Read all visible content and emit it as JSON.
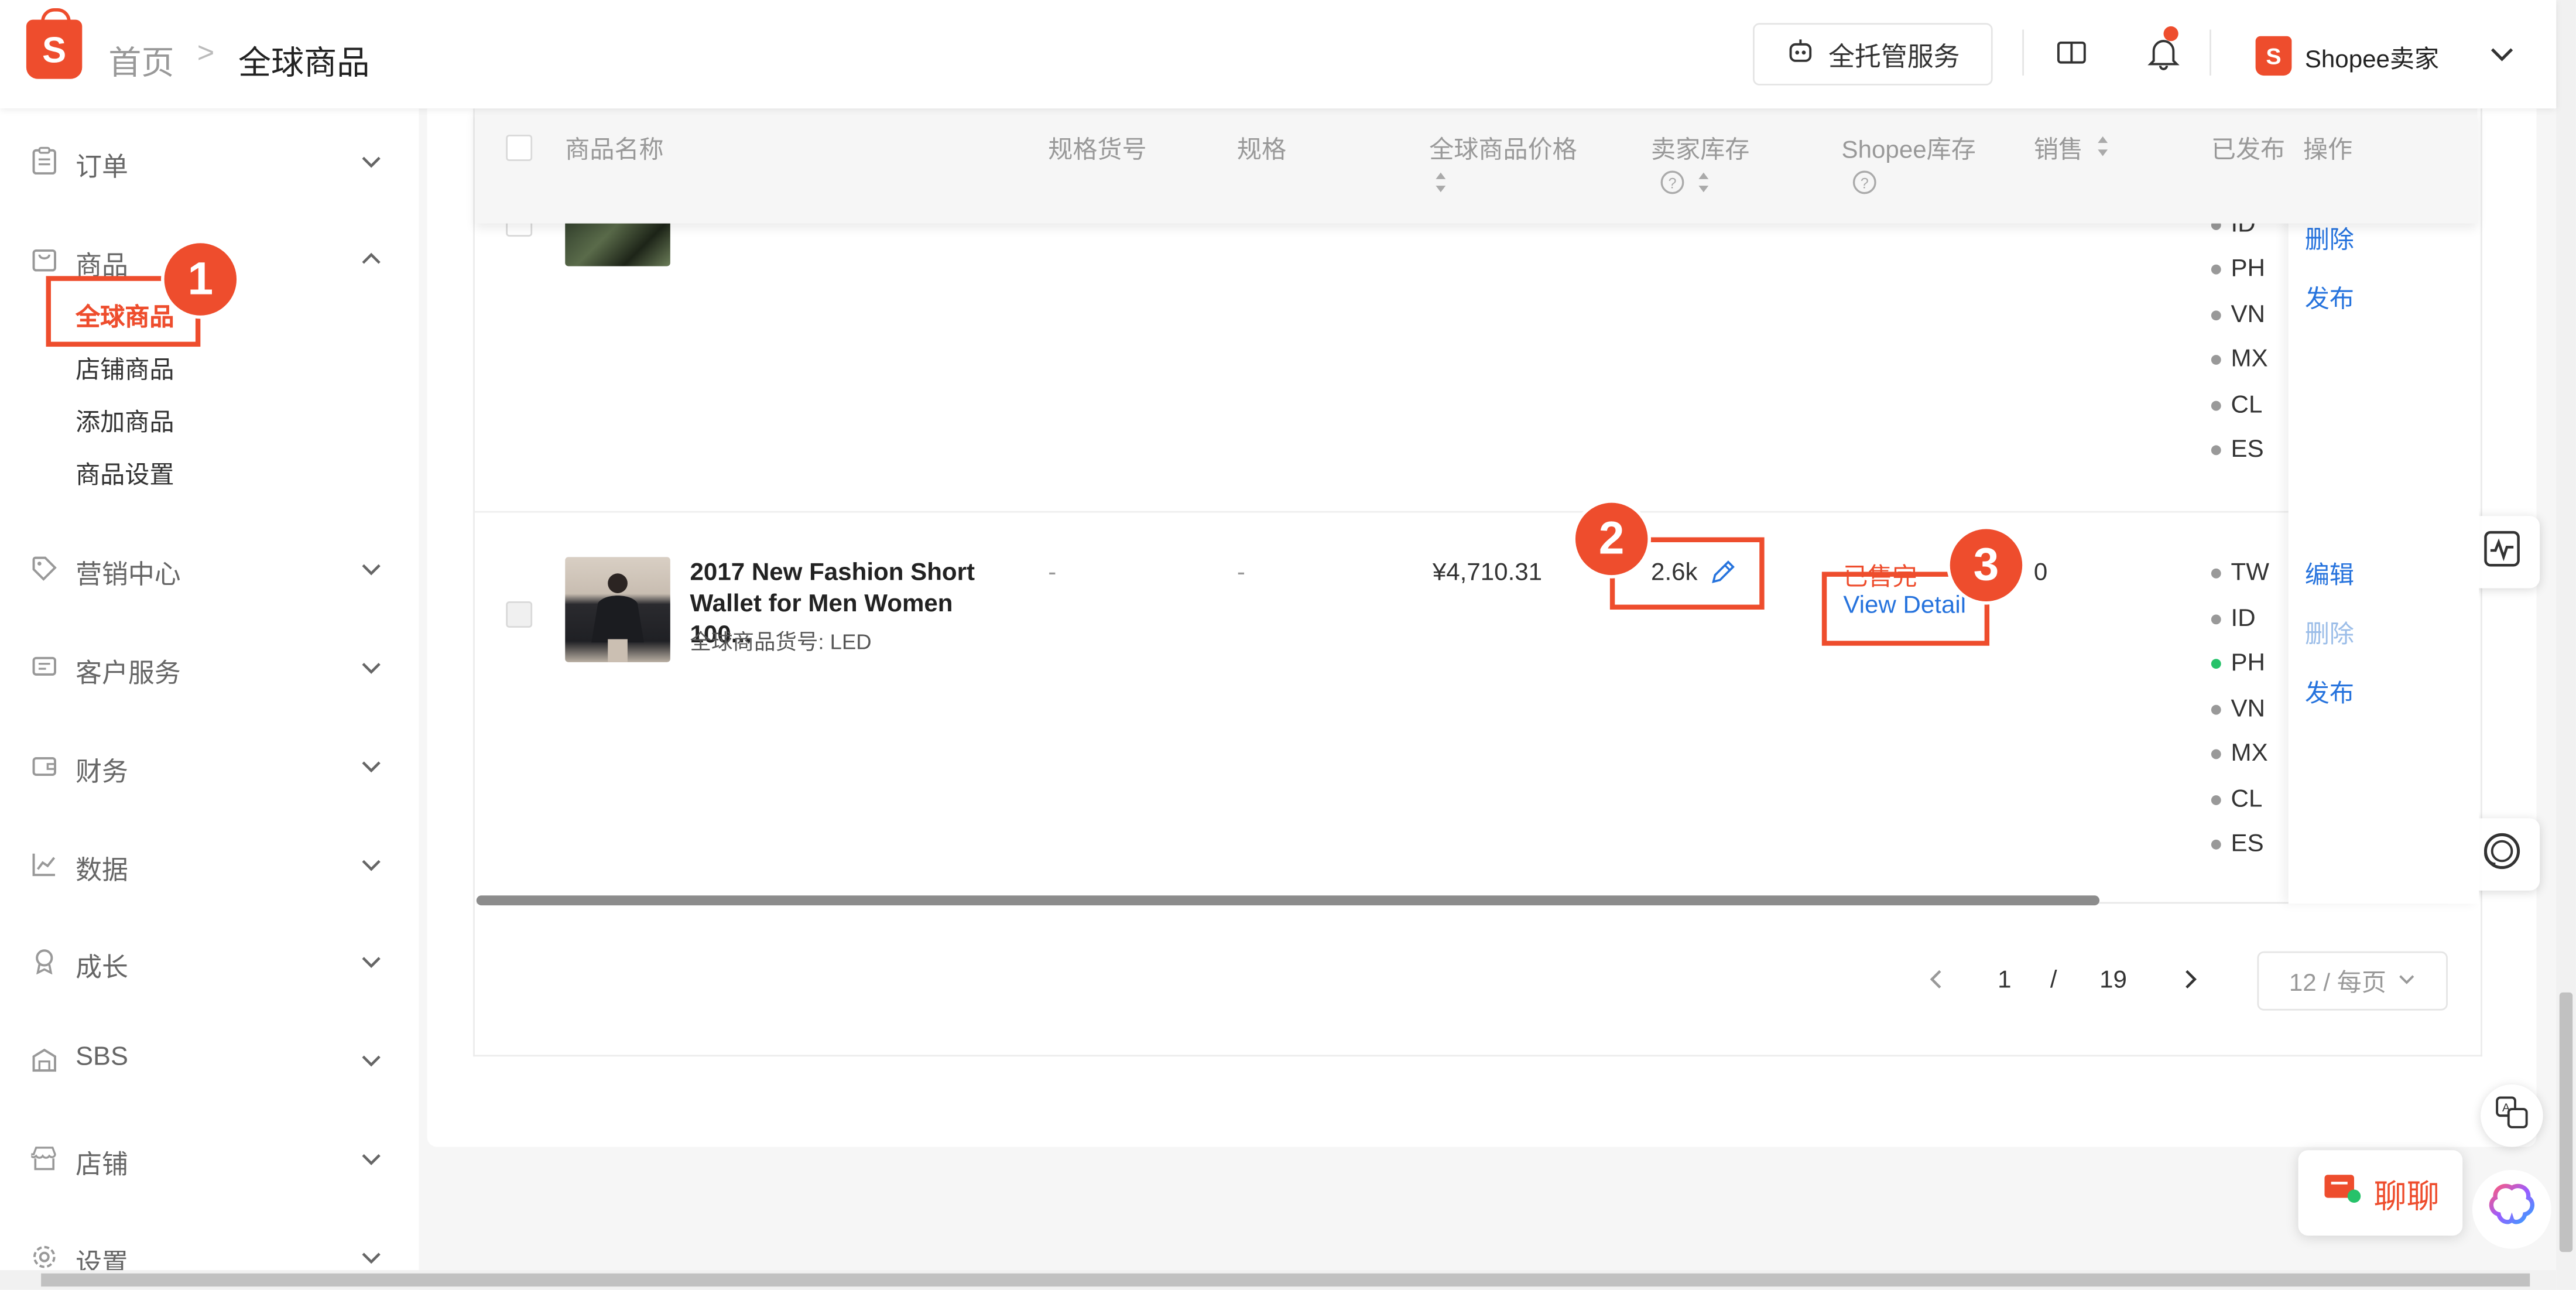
{
  "header": {
    "breadcrumb_home": "首页",
    "breadcrumb_sep": ">",
    "breadcrumb_current": "全球商品",
    "service_button": "全托管服务",
    "seller_logo": "S",
    "seller_name": "Shopee卖家"
  },
  "logo": {
    "letter": "S"
  },
  "sidebar": {
    "groups": [
      {
        "label": "订单"
      },
      {
        "label": "商品"
      },
      {
        "label": "营销中心"
      },
      {
        "label": "客户服务"
      },
      {
        "label": "财务"
      },
      {
        "label": "数据"
      },
      {
        "label": "成长"
      },
      {
        "label": "SBS"
      },
      {
        "label": "店铺"
      },
      {
        "label": "设置"
      }
    ],
    "product_sub": [
      "全球商品",
      "店铺商品",
      "添加商品",
      "商品设置"
    ]
  },
  "steps": [
    "1",
    "2",
    "3"
  ],
  "table": {
    "headers": {
      "name": "商品名称",
      "sku": "规格货号",
      "spec": "规格",
      "price": "全球商品价格",
      "seller_stock": "卖家库存",
      "shopee_stock": "Shopee库存",
      "sales": "销售",
      "published": "已发布",
      "ops": "操作"
    },
    "row1": {
      "regions": [
        "ID",
        "PH",
        "VN",
        "MX",
        "CL",
        "ES"
      ],
      "ops": [
        "删除",
        "发布"
      ]
    },
    "row2": {
      "title": "2017 New Fashion Short Wallet for Men Women 100...",
      "sku": "全球商品货号: LED",
      "sku_val": "-",
      "spec_val": "-",
      "price": "¥4,710.31",
      "seller_stock": "2.6k",
      "shopee_stock_status": "已售完",
      "view_detail": "View Detail",
      "sales": "0",
      "regions": [
        "TW",
        "ID",
        "PH",
        "VN",
        "MX",
        "CL",
        "ES"
      ],
      "ops": [
        "编辑",
        "删除",
        "发布"
      ]
    }
  },
  "pagination": {
    "current": "1",
    "sep": "/",
    "total": "19",
    "page_size": "12 / 每页"
  },
  "chat": {
    "label": "聊聊"
  },
  "colors": {
    "brand": "#ee4d2d",
    "link": "#2673dd",
    "online": "#26c26a"
  }
}
